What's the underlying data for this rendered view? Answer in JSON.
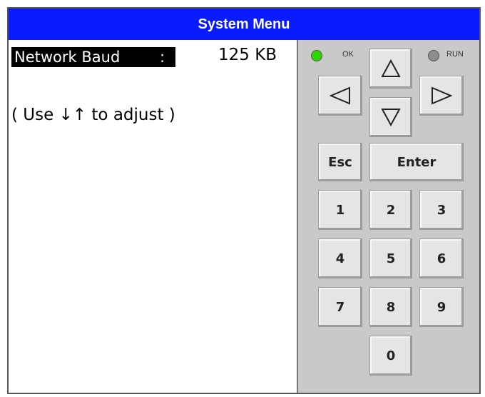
{
  "title": "System Menu",
  "screen": {
    "field_label": "Network Baud",
    "field_colon": ":",
    "field_value": "125 KB",
    "hint": "( Use ↓↑ to adjust )"
  },
  "indicators": {
    "ok_label": "OK",
    "ok_color": "#2ed400",
    "run_label": "RUN",
    "run_color": "#8d8d8d"
  },
  "keys": {
    "up": "up-arrow-icon",
    "down": "down-arrow-icon",
    "left": "left-arrow-icon",
    "right": "right-arrow-icon",
    "esc": "Esc",
    "enter": "Enter",
    "digits": [
      "1",
      "2",
      "3",
      "4",
      "5",
      "6",
      "7",
      "8",
      "9",
      "0"
    ]
  },
  "colors": {
    "title_bar": "#0a1bff",
    "keypad_bg": "#c9c9c9"
  }
}
